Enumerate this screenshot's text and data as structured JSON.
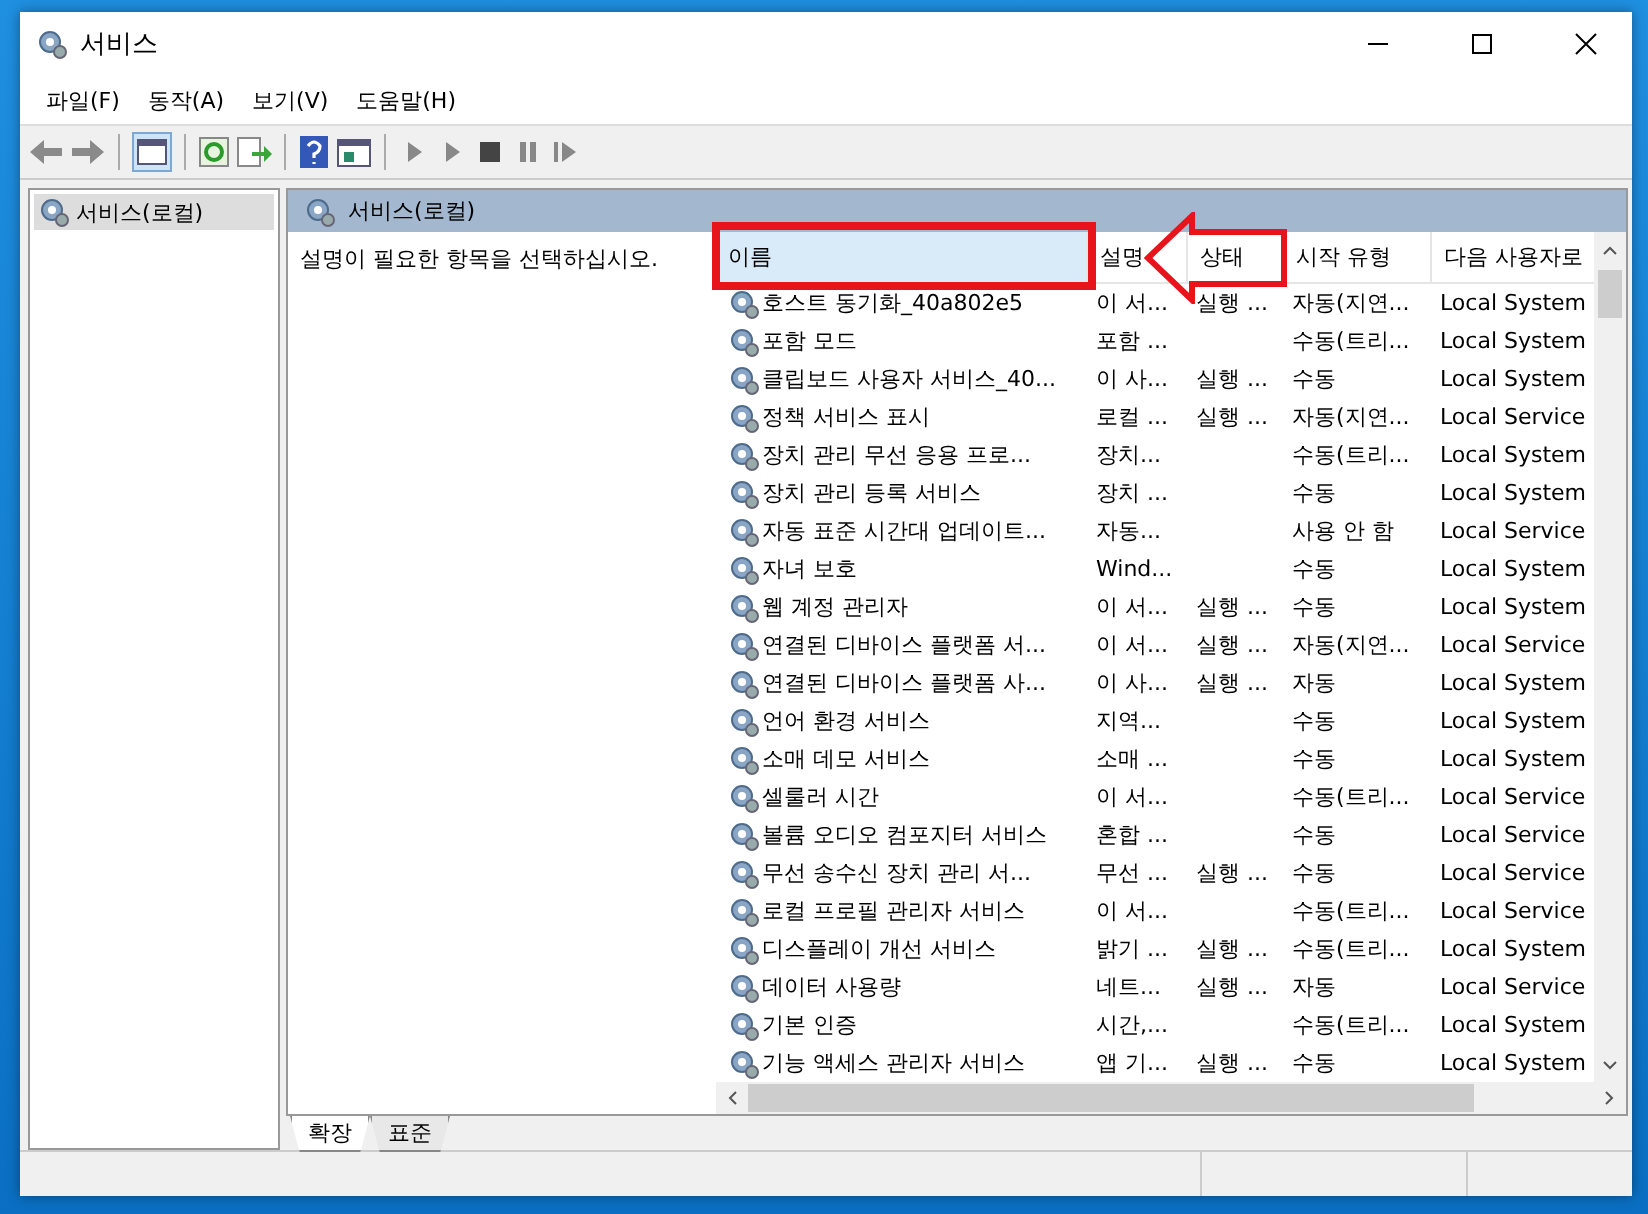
{
  "window": {
    "title": "서비스"
  },
  "menu": [
    "파일(F)",
    "동작(A)",
    "보기(V)",
    "도움말(H)"
  ],
  "tree": [
    {
      "label": "서비스(로컬)",
      "selected": true
    }
  ],
  "pane": {
    "title": "서비스(로컬)",
    "description": "설명이 필요한 항목을 선택하십시오."
  },
  "table": {
    "columns": [
      "이름",
      "설명",
      "상태",
      "시작 유형",
      "다음 사용자로"
    ],
    "rows": [
      [
        "호스트 동기화_40a802e5",
        "이 서...",
        "실행 ...",
        "자동(지연...",
        "Local System"
      ],
      [
        "포함 모드",
        "포함 ...",
        "",
        "수동(트리...",
        "Local System"
      ],
      [
        "클립보드 사용자 서비스_40...",
        "이 사...",
        "실행 ...",
        "수동",
        "Local System"
      ],
      [
        "정책 서비스 표시",
        "로컬 ...",
        "실행 ...",
        "자동(지연...",
        "Local Service"
      ],
      [
        "장치 관리 무선 응용 프로...",
        "장치...",
        "",
        "수동(트리...",
        "Local System"
      ],
      [
        "장치 관리 등록 서비스",
        "장치 ...",
        "",
        "수동",
        "Local System"
      ],
      [
        "자동 표준 시간대 업데이트...",
        "자동...",
        "",
        "사용 안 함",
        "Local Service"
      ],
      [
        "자녀 보호",
        "Wind...",
        "",
        "수동",
        "Local System"
      ],
      [
        "웹 계정 관리자",
        "이 서...",
        "실행 ...",
        "수동",
        "Local System"
      ],
      [
        "연결된 디바이스 플랫폼 서...",
        "이 서...",
        "실행 ...",
        "자동(지연...",
        "Local Service"
      ],
      [
        "연결된 디바이스 플랫폼 사...",
        "이 사...",
        "실행 ...",
        "자동",
        "Local System"
      ],
      [
        "언어 환경 서비스",
        "지역...",
        "",
        "수동",
        "Local System"
      ],
      [
        "소매 데모 서비스",
        "소매 ...",
        "",
        "수동",
        "Local System"
      ],
      [
        "셀룰러 시간",
        "이 서...",
        "",
        "수동(트리...",
        "Local Service"
      ],
      [
        "볼륨 오디오 컴포지터 서비스",
        "혼합 ...",
        "",
        "수동",
        "Local Service"
      ],
      [
        "무선 송수신 장치 관리 서...",
        "무선 ...",
        "실행 ...",
        "수동",
        "Local Service"
      ],
      [
        "로컬 프로필 관리자 서비스",
        "이 서...",
        "",
        "수동(트리...",
        "Local Service"
      ],
      [
        "디스플레이 개선 서비스",
        "밝기 ...",
        "실행 ...",
        "수동(트리...",
        "Local System"
      ],
      [
        "데이터 사용량",
        "네트...",
        "실행 ...",
        "자동",
        "Local Service"
      ],
      [
        "기본 인증",
        "시간,...",
        "",
        "수동(트리...",
        "Local System"
      ],
      [
        "기능 액세스 관리자 서비스",
        "앱 기...",
        "실행 ...",
        "수동",
        "Local System"
      ]
    ]
  },
  "tabs": [
    {
      "label": "확장",
      "selected": true
    },
    {
      "label": "표준",
      "selected": false
    }
  ]
}
